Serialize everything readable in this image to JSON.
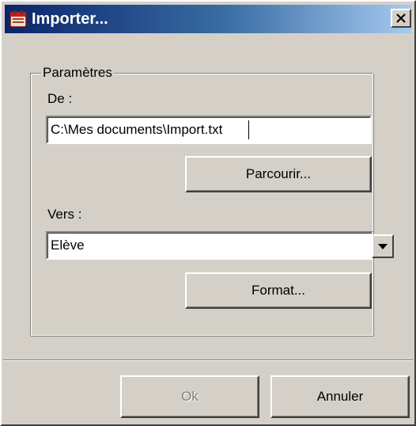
{
  "window": {
    "title": "Importer...",
    "icon": "calendar-icon",
    "close_icon": "close-icon"
  },
  "group": {
    "legend": "Paramètres",
    "from_label": "De :",
    "from_value": "C:\\Mes documents\\Import.txt",
    "browse_label": "Parcourir...",
    "to_label": "Vers :",
    "to_value": "Elève",
    "format_label": "Format..."
  },
  "footer": {
    "ok_label": "Ok",
    "ok_enabled": false,
    "cancel_label": "Annuler"
  },
  "colors": {
    "face": "#d4d0c8",
    "title_start": "#0a246a",
    "title_end": "#a6caf0"
  }
}
